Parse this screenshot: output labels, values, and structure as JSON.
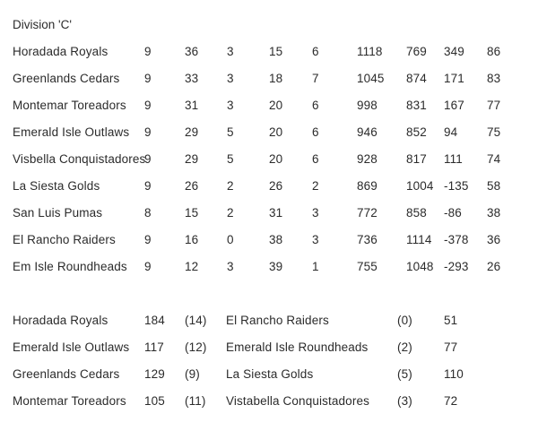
{
  "document": {
    "title": "Division 'C'"
  },
  "league_table": {
    "rows": [
      {
        "team": "Horadada Royals",
        "played": "9",
        "won": "36",
        "drawn": "3",
        "lost": "15",
        "bonus": "6",
        "points_for": "1118",
        "points_against": "769",
        "points_diff": "349",
        "points": "86"
      },
      {
        "team": "Greenlands Cedars",
        "played": "9",
        "won": "33",
        "drawn": "3",
        "lost": "18",
        "bonus": "7",
        "points_for": "1045",
        "points_against": "874",
        "points_diff": "171",
        "points": "83"
      },
      {
        "team": "Montemar Toreadors",
        "played": "9",
        "won": "31",
        "drawn": "3",
        "lost": "20",
        "bonus": "6",
        "points_for": "998",
        "points_against": "831",
        "points_diff": "167",
        "points": "77"
      },
      {
        "team": "Emerald Isle Outlaws",
        "played": "9",
        "won": "29",
        "drawn": "5",
        "lost": "20",
        "bonus": "6",
        "points_for": "946",
        "points_against": "852",
        "points_diff": "94",
        "points": "75"
      },
      {
        "team": "Visbella Conquistadores",
        "played": "9",
        "won": "29",
        "drawn": "5",
        "lost": "20",
        "bonus": "6",
        "points_for": "928",
        "points_against": "817",
        "points_diff": "111",
        "points": "74"
      },
      {
        "team": "La Siesta Golds",
        "played": "9",
        "won": "26",
        "drawn": "2",
        "lost": "26",
        "bonus": "2",
        "points_for": "869",
        "points_against": "1004",
        "points_diff": "-135",
        "points": "58"
      },
      {
        "team": "San Luis Pumas",
        "played": "8",
        "won": "15",
        "drawn": "2",
        "lost": "31",
        "bonus": "3",
        "points_for": "772",
        "points_against": "858",
        "points_diff": "-86",
        "points": "38"
      },
      {
        "team": "El Rancho Raiders",
        "played": "9",
        "won": "16",
        "drawn": "0",
        "lost": "38",
        "bonus": "3",
        "points_for": "736",
        "points_against": "1114",
        "points_diff": "-378",
        "points": "36"
      },
      {
        "team": "Em Isle Roundheads",
        "played": "9",
        "won": "12",
        "drawn": "3",
        "lost": "39",
        "bonus": "1",
        "points_for": "755",
        "points_against": "1048",
        "points_diff": "-293",
        "points": "26"
      }
    ]
  },
  "results": {
    "rows": [
      {
        "home_team": "Horadada Royals",
        "home_score": "184",
        "home_bonus": "(14)",
        "away_team": "El Rancho Raiders",
        "away_bonus": "(0)",
        "away_score": "51"
      },
      {
        "home_team": "Emerald Isle Outlaws",
        "home_score": "117",
        "home_bonus": "(12)",
        "away_team": "Emerald Isle Roundheads",
        "away_bonus": "(2)",
        "away_score": "77"
      },
      {
        "home_team": "Greenlands Cedars",
        "home_score": "129",
        "home_bonus": "(9)",
        "away_team": "La Siesta Golds",
        "away_bonus": "(5)",
        "away_score": "110"
      },
      {
        "home_team": "Montemar Toreadors",
        "home_score": "105",
        "home_bonus": "(11)",
        "away_team": "Vistabella Conquistadores",
        "away_bonus": "(3)",
        "away_score": "72"
      }
    ]
  },
  "style": {
    "text_color": "#2b2b2b",
    "background_color": "#ffffff"
  }
}
